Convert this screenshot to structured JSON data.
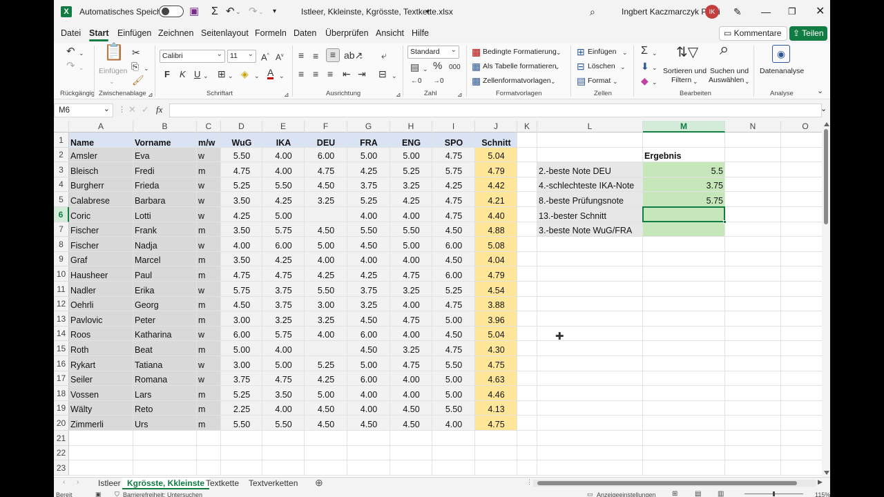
{
  "titlebar": {
    "autosave_label": "Automatisches Speichern",
    "file_name": "Istleer, Kkleinste, Kgrösste, Textkette.xlsx",
    "user_name": "Ingbert Kaczmarczyk Präsi",
    "avatar_initials": "IK"
  },
  "menu": {
    "items": [
      "Datei",
      "Start",
      "Einfügen",
      "Zeichnen",
      "Seitenlayout",
      "Formeln",
      "Daten",
      "Überprüfen",
      "Ansicht",
      "Hilfe"
    ],
    "comments_label": "Kommentare",
    "share_label": "Teilen"
  },
  "ribbon": {
    "undo_group": "Rückgängig",
    "clipboard_group": "Zwischenablage",
    "paste_label": "Einfügen",
    "font_group": "Schriftart",
    "font_name": "Calibri",
    "font_size": "11",
    "bold": "F",
    "italic": "K",
    "underline": "U",
    "align_group": "Ausrichtung",
    "number_group": "Zahl",
    "number_format": "Standard",
    "formats_group": "Formatvorlagen",
    "cond_format": "Bedingte Formatierung",
    "as_table": "Als Tabelle formatieren",
    "cell_styles": "Zellenformatvorlagen",
    "cells_group": "Zellen",
    "insert": "Einfügen",
    "delete": "Löschen",
    "format": "Format",
    "edit_group": "Bearbeiten",
    "sort_filter_1": "Sortieren und",
    "sort_filter_2": "Filtern",
    "find_select_1": "Suchen und",
    "find_select_2": "Auswählen",
    "analysis_group": "Analyse",
    "data_analysis": "Datenanalyse"
  },
  "formula_bar": {
    "name_box": "M6",
    "fx": "fx",
    "formula": ""
  },
  "columns": [
    "A",
    "B",
    "C",
    "D",
    "E",
    "F",
    "G",
    "H",
    "I",
    "J",
    "K",
    "L",
    "M",
    "N",
    "O"
  ],
  "selected_column": "M",
  "selected_row": "6",
  "table": {
    "headers": [
      "Name",
      "Vorname",
      "m/w",
      "WuG",
      "IKA",
      "DEU",
      "FRA",
      "ENG",
      "SPO",
      "Schnitt"
    ],
    "rows": [
      [
        "Amsler",
        "Eva",
        "w",
        "5.50",
        "4.00",
        "6.00",
        "5.00",
        "5.00",
        "4.75",
        "5.04"
      ],
      [
        "Bleisch",
        "Fredi",
        "m",
        "4.75",
        "4.00",
        "4.75",
        "4.25",
        "5.25",
        "5.75",
        "4.79"
      ],
      [
        "Burgherr",
        "Frieda",
        "w",
        "5.25",
        "5.50",
        "4.50",
        "3.75",
        "3.25",
        "4.25",
        "4.42"
      ],
      [
        "Calabrese",
        "Barbara",
        "w",
        "3.50",
        "4.25",
        "3.25",
        "5.25",
        "4.25",
        "4.75",
        "4.21"
      ],
      [
        "Coric",
        "Lotti",
        "w",
        "4.25",
        "5.00",
        "",
        "4.00",
        "4.00",
        "4.75",
        "4.40"
      ],
      [
        "Fischer",
        "Frank",
        "m",
        "3.50",
        "5.75",
        "4.50",
        "5.50",
        "5.50",
        "4.50",
        "4.88"
      ],
      [
        "Fischer",
        "Nadja",
        "w",
        "4.00",
        "6.00",
        "5.00",
        "4.50",
        "5.00",
        "6.00",
        "5.08"
      ],
      [
        "Graf",
        "Marcel",
        "m",
        "3.50",
        "4.25",
        "4.00",
        "4.00",
        "4.00",
        "4.50",
        "4.04"
      ],
      [
        "Hausheer",
        "Paul",
        "m",
        "4.75",
        "4.75",
        "4.25",
        "4.25",
        "4.75",
        "6.00",
        "4.79"
      ],
      [
        "Nadler",
        "Erika",
        "w",
        "5.75",
        "3.75",
        "5.50",
        "3.75",
        "3.25",
        "5.25",
        "4.54"
      ],
      [
        "Oehrli",
        "Georg",
        "m",
        "4.50",
        "3.75",
        "3.00",
        "3.25",
        "4.00",
        "4.75",
        "3.88"
      ],
      [
        "Pavlovic",
        "Peter",
        "m",
        "3.00",
        "3.25",
        "3.25",
        "4.50",
        "4.75",
        "5.00",
        "3.96"
      ],
      [
        "Roos",
        "Katharina",
        "w",
        "6.00",
        "5.75",
        "4.00",
        "6.00",
        "4.00",
        "4.50",
        "5.04"
      ],
      [
        "Roth",
        "Beat",
        "m",
        "5.00",
        "4.00",
        "",
        "4.50",
        "3.25",
        "4.75",
        "4.30"
      ],
      [
        "Rykart",
        "Tatiana",
        "w",
        "3.00",
        "5.00",
        "5.25",
        "5.00",
        "4.75",
        "5.50",
        "4.75"
      ],
      [
        "Seiler",
        "Romana",
        "w",
        "3.75",
        "4.75",
        "4.25",
        "6.00",
        "4.00",
        "5.00",
        "4.63"
      ],
      [
        "Vossen",
        "Lars",
        "m",
        "5.25",
        "3.50",
        "5.00",
        "4.00",
        "4.00",
        "5.00",
        "4.46"
      ],
      [
        "Wälty",
        "Reto",
        "m",
        "2.25",
        "4.00",
        "4.50",
        "4.00",
        "4.50",
        "5.50",
        "4.13"
      ],
      [
        "Zimmerli",
        "Urs",
        "m",
        "5.50",
        "5.50",
        "4.50",
        "4.50",
        "4.50",
        "4.00",
        "4.75"
      ]
    ]
  },
  "results": {
    "header": "Ergebnis",
    "items": [
      {
        "label": "2.-beste Note DEU",
        "value": "5.5"
      },
      {
        "label": "4.-schlechteste IKA-Note",
        "value": "3.75"
      },
      {
        "label": "8.-beste Prüfungsnote",
        "value": "5.75"
      },
      {
        "label": "13.-bester Schnitt",
        "value": ""
      },
      {
        "label": "3.-beste Note WuG/FRA",
        "value": ""
      }
    ]
  },
  "sheets": [
    "Istleer",
    "Kgrösste, Kkleinste",
    "Textkette",
    "Textverketten"
  ],
  "active_sheet": "Kgrösste, Kkleinste",
  "status": {
    "ready": "Bereit",
    "accessibility": "Barrierefreiheit: Untersuchen",
    "display_settings": "Anzeigeeinstellungen",
    "zoom": "115%"
  },
  "colors": {
    "excel_green": "#107c41",
    "header_fill": "#dae3f3",
    "name_fill": "#d9d9d9",
    "grade_fill": "#f2f2f2",
    "average_fill": "#ffe699",
    "result_fill": "#c6e7b9"
  }
}
